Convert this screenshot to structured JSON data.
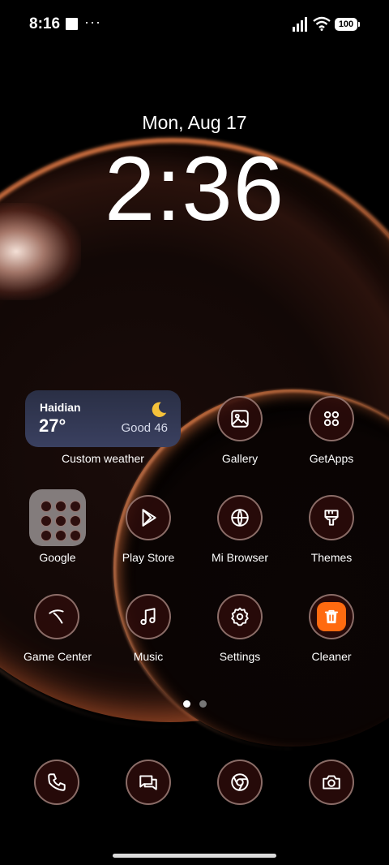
{
  "status": {
    "time": "8:16",
    "dots": "···",
    "battery": "100"
  },
  "lock": {
    "date": "Mon, Aug 17",
    "time": "2:36"
  },
  "weather": {
    "city": "Haidian",
    "temp": "27°",
    "aqi": "Good 46",
    "label": "Custom weather"
  },
  "apps": {
    "gallery": "Gallery",
    "getapps": "GetApps",
    "google": "Google",
    "playstore": "Play Store",
    "browser": "Mi Browser",
    "themes": "Themes",
    "gamecenter": "Game Center",
    "music": "Music",
    "settings": "Settings",
    "cleaner": "Cleaner"
  },
  "dock": [
    "phone-icon",
    "messages-icon",
    "chrome-icon",
    "camera-icon"
  ],
  "colors": {
    "accent": "#ff6a10",
    "icon_bg": "#2d0c0a"
  }
}
